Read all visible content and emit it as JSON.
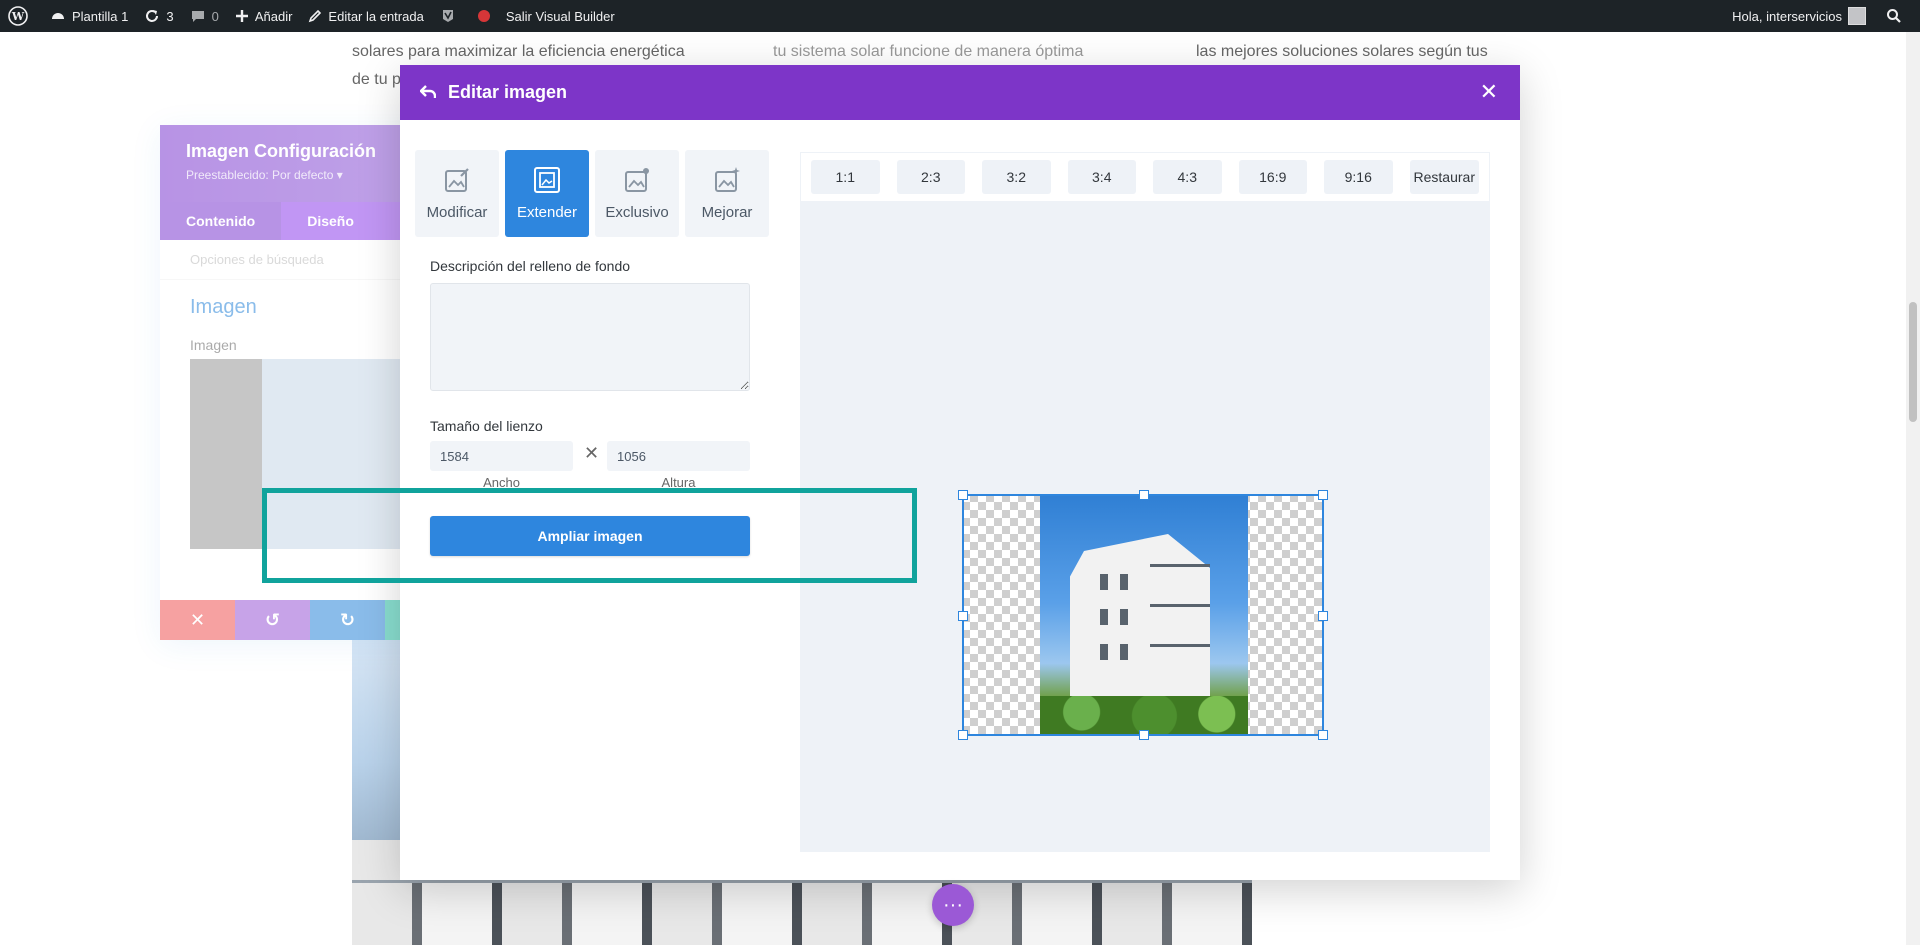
{
  "adminbar": {
    "site_name": "Plantilla 1",
    "updates_count": "3",
    "comments_count": "0",
    "add_new": "Añadir",
    "edit_entry": "Editar la entrada",
    "exit_builder": "Salir Visual Builder",
    "greeting": "Hola, interservicios"
  },
  "background": {
    "col1_line1": "solares para maximizar la eficiencia energética",
    "col1_line2": "de tu p",
    "col2_line1": "tu sistema solar funcione de manera óptima",
    "col3_line1": "las mejores soluciones solares según tus"
  },
  "settings_panel": {
    "title": "Imagen Configuración",
    "preset": "Preestablecido: Por defecto ▾",
    "tabs": [
      "Contenido",
      "Diseño"
    ],
    "search": "Opciones de búsqueda",
    "section_title": "Imagen",
    "field_label": "Imagen"
  },
  "modal": {
    "title": "Editar imagen",
    "tools": [
      {
        "label": "Modificar",
        "icon": "edit-image-icon"
      },
      {
        "label": "Extender",
        "icon": "extend-image-icon"
      },
      {
        "label": "Exclusivo",
        "icon": "exclusive-image-icon"
      },
      {
        "label": "Mejorar",
        "icon": "enhance-image-icon"
      }
    ],
    "active_tool": "Extender",
    "fill_label": "Descripción del relleno de fondo",
    "fill_value": "",
    "canvas_size_label": "Tamaño del lienzo",
    "width_value": "1584",
    "height_value": "1056",
    "width_label": "Ancho",
    "height_label": "Altura",
    "times_symbol": "✕",
    "extend_button": "Ampliar imagen",
    "ratios": [
      "1:1",
      "2:3",
      "3:2",
      "3:4",
      "4:3",
      "16:9",
      "9:16"
    ],
    "reset": "Restaurar"
  },
  "fab_label": "···",
  "colors": {
    "modal_header": "#7d35c8",
    "primary": "#2e86de",
    "highlight": "#10a39c"
  }
}
